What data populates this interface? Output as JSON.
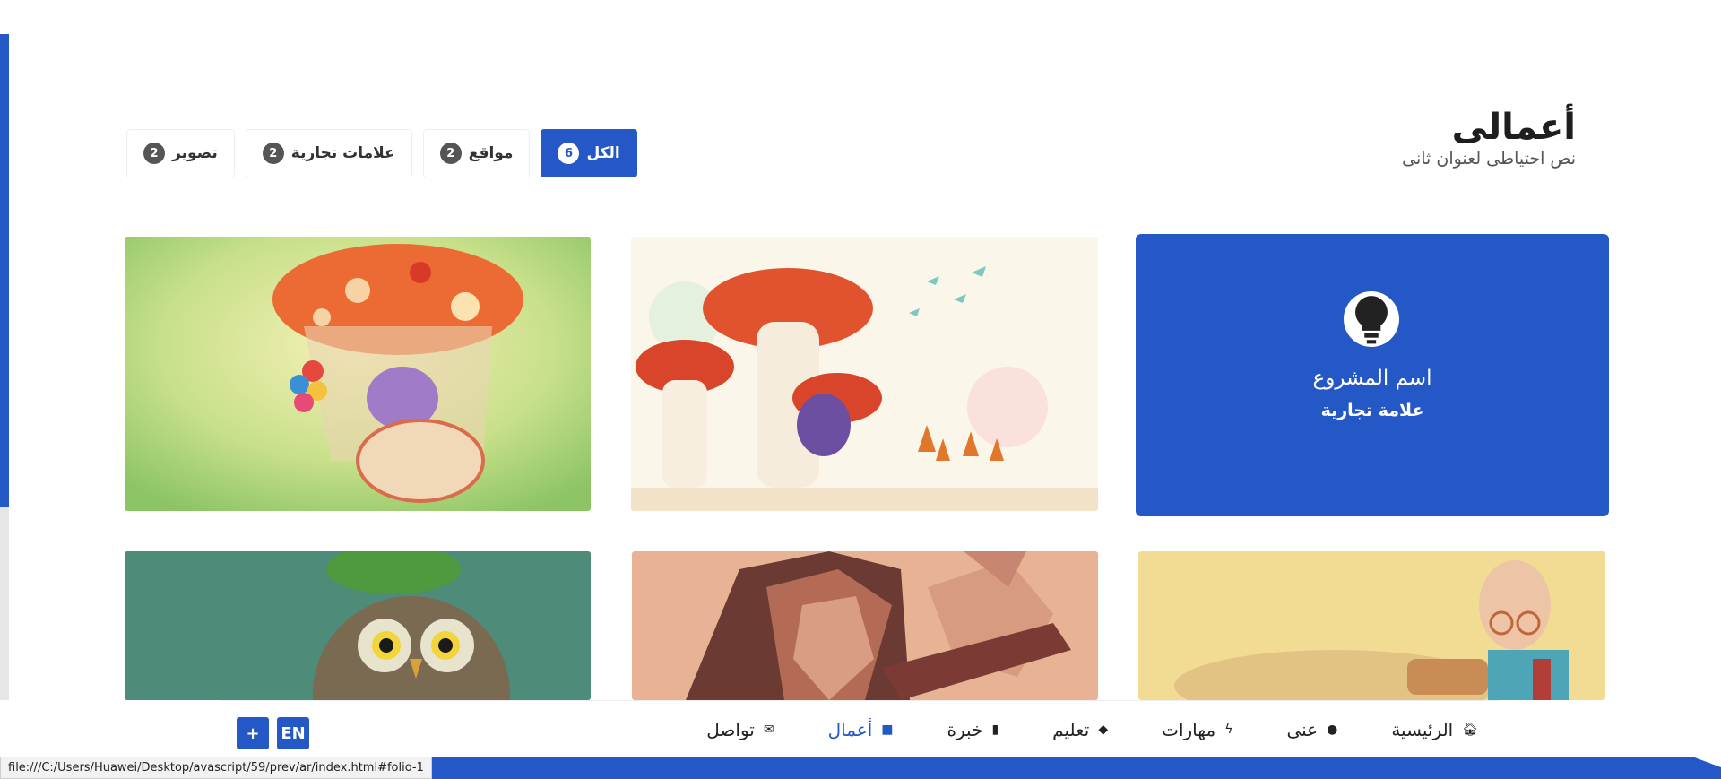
{
  "section": {
    "title": "أعمالى",
    "subtitle": "نص احتياطى لعنوان ثانى"
  },
  "filters": [
    {
      "label": "الكل",
      "count": "6",
      "active": true
    },
    {
      "label": "مواقع",
      "count": "2"
    },
    {
      "label": "علامات تجارية",
      "count": "2"
    },
    {
      "label": "تصوير",
      "count": "2"
    }
  ],
  "featured_card": {
    "icon": "lightbulb-icon",
    "name": "اسم المشروع",
    "category": "علامة تجارية"
  },
  "nav": {
    "items": [
      {
        "label": "الرئيسية",
        "icon": "home-icon"
      },
      {
        "label": "عنى",
        "icon": "user-icon"
      },
      {
        "label": "مهارات",
        "icon": "bolt-icon"
      },
      {
        "label": "تعليم",
        "icon": "graduation-cap-icon"
      },
      {
        "label": "خبرة",
        "icon": "book-icon"
      },
      {
        "label": "أعمال",
        "icon": "briefcase-icon",
        "active": true
      },
      {
        "label": "تواصل",
        "icon": "envelope-icon"
      }
    ],
    "lang_button": "EN",
    "plus_button": "+"
  },
  "status_url": "file:///C:/Users/Huawei/Desktop/avascript/59/prev/ar/index.html#folio-1",
  "colors": {
    "accent": "#2458c6"
  }
}
